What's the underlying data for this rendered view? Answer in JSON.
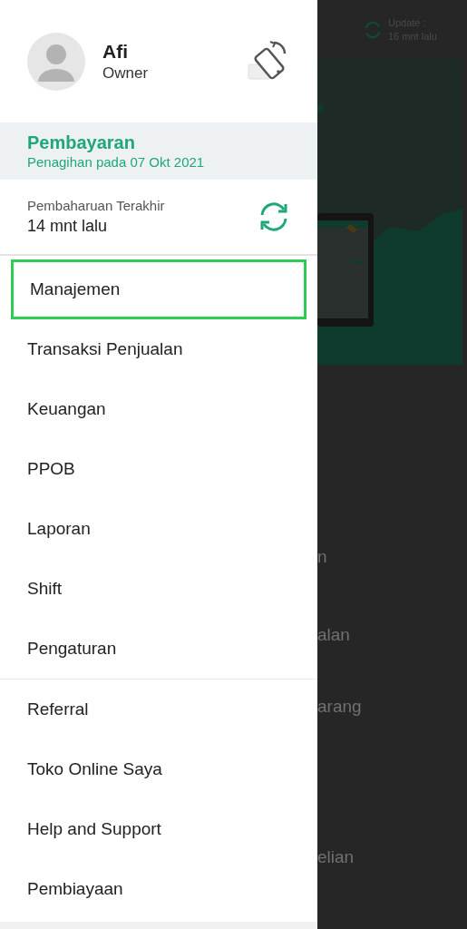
{
  "background": {
    "update_label": "Update :",
    "update_time": "16 mnt lalu",
    "menu_fragments": [
      "n",
      "alan",
      "arang",
      "elian"
    ]
  },
  "drawer": {
    "profile": {
      "name": "Afi",
      "role": "Owner"
    },
    "payment": {
      "title": "Pembayaran",
      "subtitle": "Penagihan pada 07 Okt 2021"
    },
    "last_update": {
      "label": "Pembaharuan Terakhir",
      "time": "14 mnt lalu"
    },
    "menu_groups": [
      [
        {
          "label": "Manajemen",
          "highlighted": true
        },
        {
          "label": "Transaksi Penjualan",
          "highlighted": false
        },
        {
          "label": "Keuangan",
          "highlighted": false
        },
        {
          "label": "PPOB",
          "highlighted": false
        },
        {
          "label": "Laporan",
          "highlighted": false
        },
        {
          "label": "Shift",
          "highlighted": false
        },
        {
          "label": "Pengaturan",
          "highlighted": false
        }
      ],
      [
        {
          "label": "Referral",
          "highlighted": false
        },
        {
          "label": "Toko Online Saya",
          "highlighted": false
        },
        {
          "label": "Help and Support",
          "highlighted": false
        },
        {
          "label": "Pembiayaan",
          "highlighted": false
        }
      ]
    ]
  }
}
